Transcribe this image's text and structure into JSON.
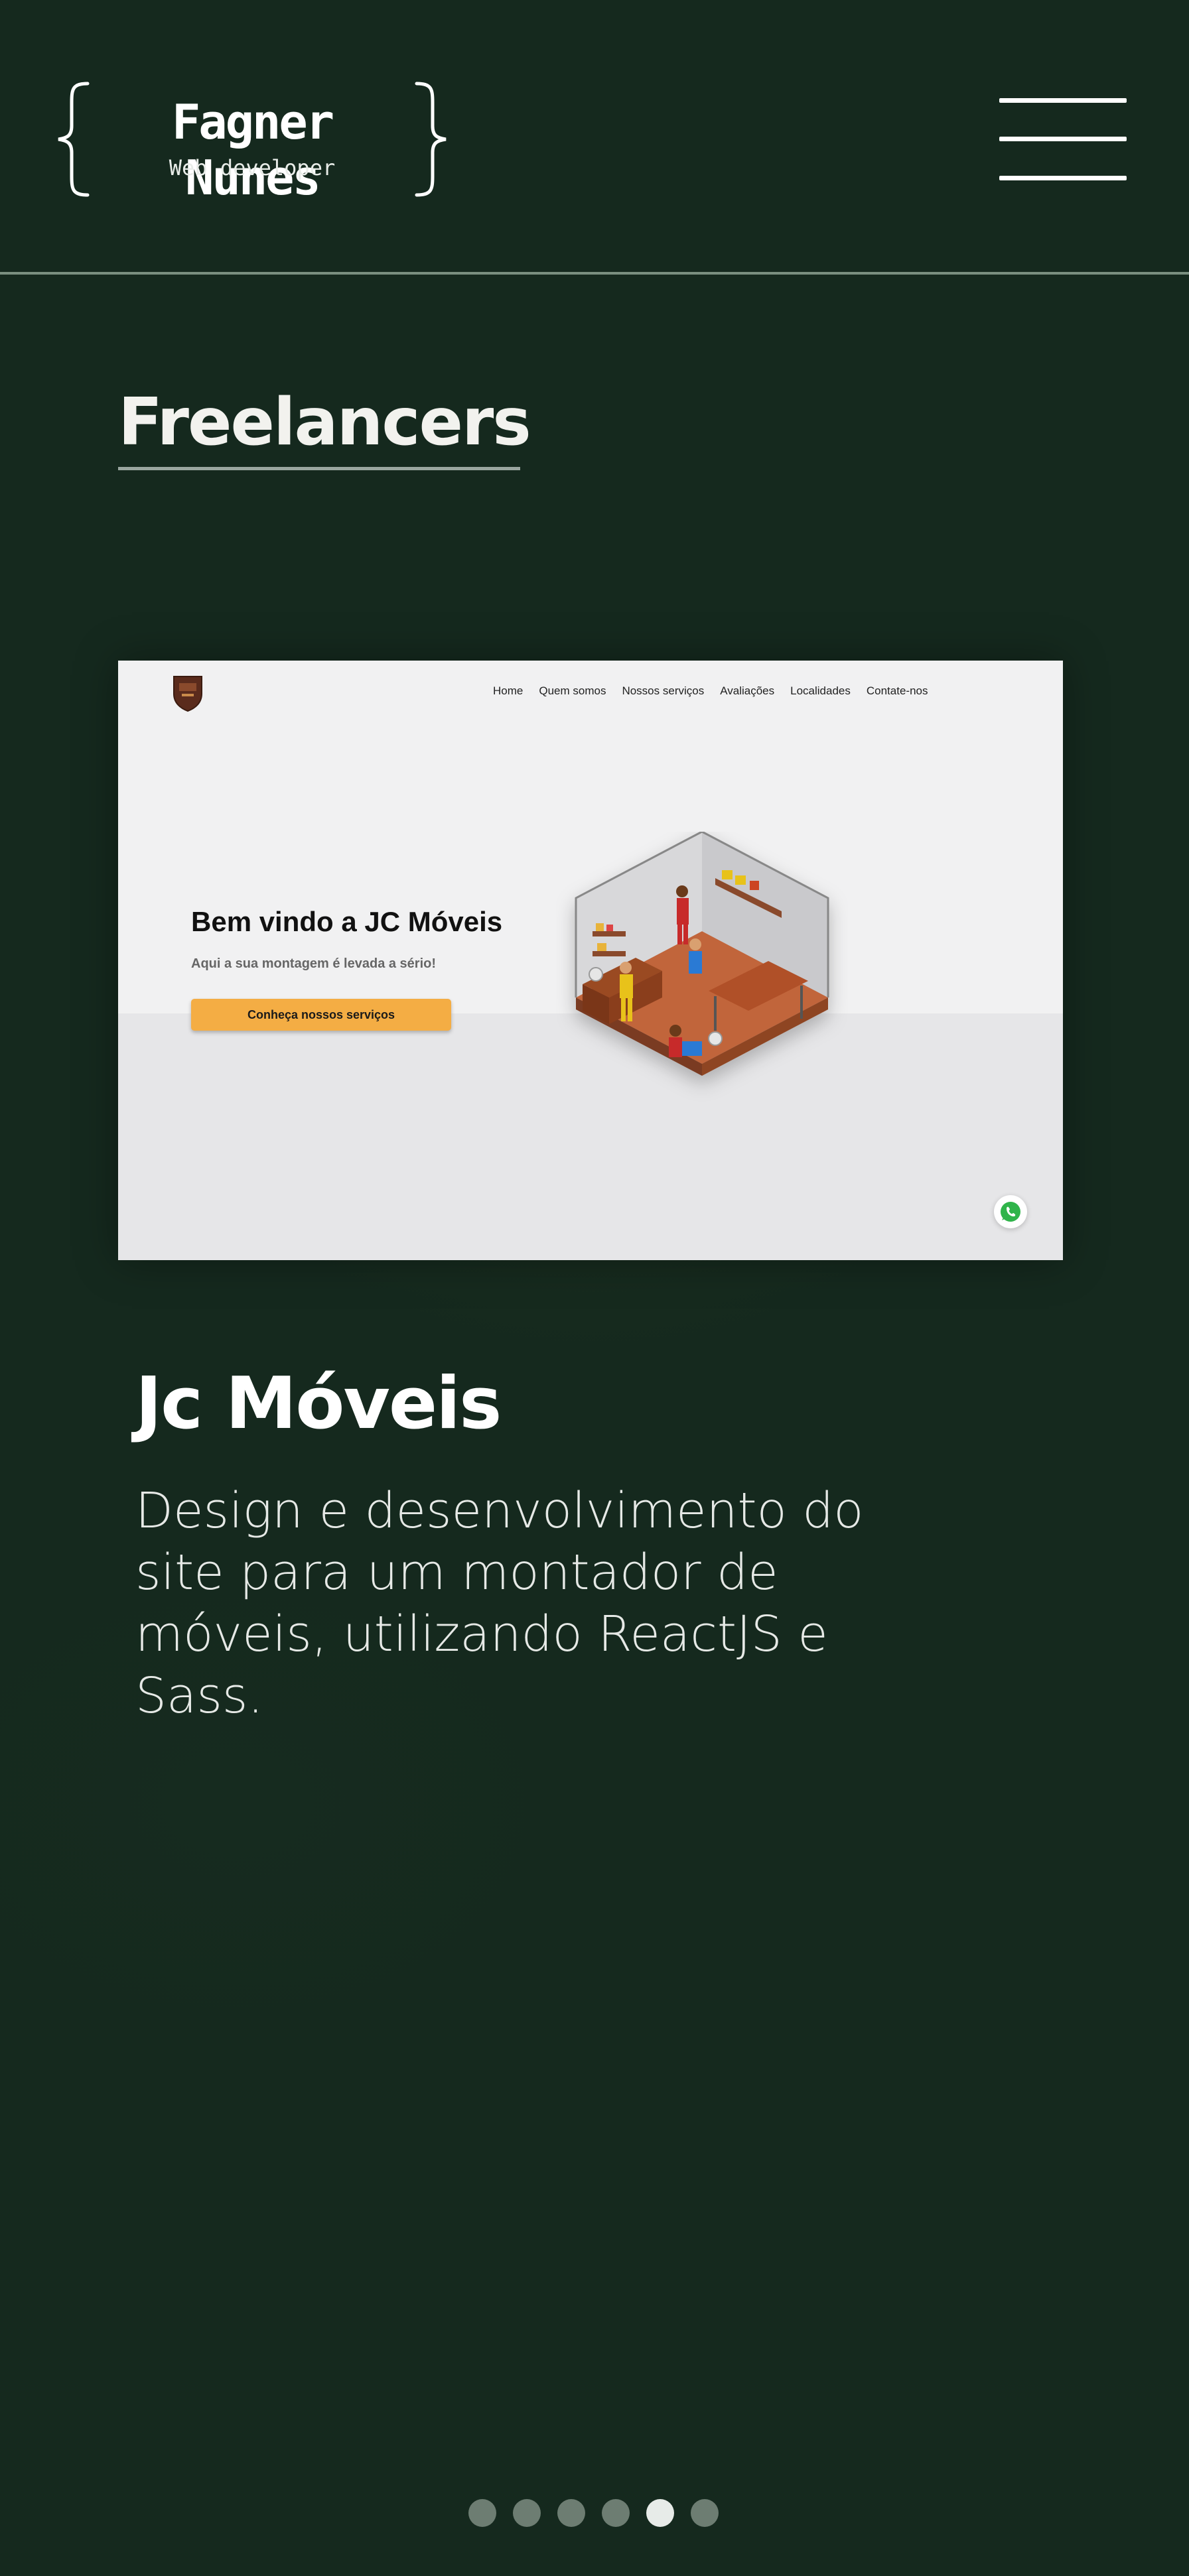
{
  "header": {
    "logo_name": "Fagner Nunes",
    "logo_subtitle": "Web developer",
    "menu_icon": "hamburger-menu-icon"
  },
  "section": {
    "title": "Freelancers"
  },
  "project": {
    "preview": {
      "nav": [
        "Home",
        "Quem somos",
        "Nossos serviços",
        "Avaliações",
        "Localidades",
        "Contate-nos"
      ],
      "heading": "Bem vindo a JC Móveis",
      "subtitle": "Aqui a sua montagem é levada a sério!",
      "cta_label": "Conheça nossos serviços",
      "accent_color": "#f4ad44",
      "floating_icon": "whatsapp-icon"
    },
    "name": "Jc Móveis",
    "description": "Design e desenvolvimento do site para um montador de móveis, utilizando ReactJS e Sass."
  },
  "carousel": {
    "total": 6,
    "active_index": 4
  },
  "colors": {
    "background": "#15291e",
    "divider": "#7a8f80",
    "dot_inactive": "#6d7d72",
    "dot_active": "#e7ebe8"
  }
}
